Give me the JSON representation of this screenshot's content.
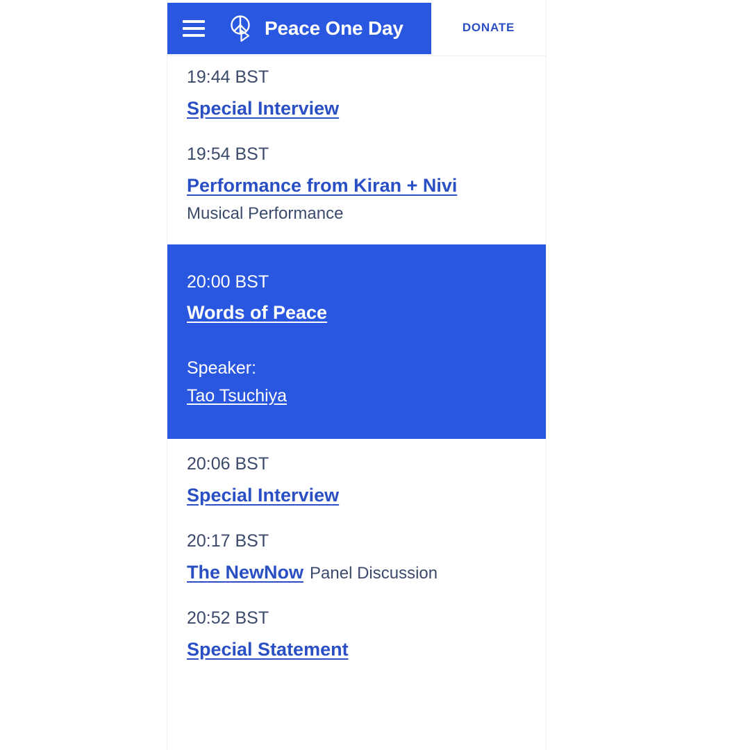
{
  "header": {
    "menu_icon": "hamburger-menu-icon",
    "logo_icon": "peace-sign-play-icon",
    "brand_title": "Peace One Day",
    "donate_label": "DONATE",
    "brand_bg": "#2a57e0",
    "donate_color": "#2a4fc4"
  },
  "colors": {
    "brand_blue": "#2a57e0",
    "link_blue": "#2a4fc4",
    "body_text": "#3b4a6b",
    "page_bg": "#ffffff",
    "highlight_text": "#ffffff"
  },
  "schedule": {
    "items": [
      {
        "time": "19:44 BST",
        "title": "Special Interview",
        "kind": "",
        "kind_inline": false,
        "highlight": false,
        "speaker_label": "",
        "speaker_name": ""
      },
      {
        "time": "19:54 BST",
        "title": "Performance from Kiran + Nivi",
        "kind": "Musical Performance",
        "kind_inline": false,
        "highlight": false,
        "speaker_label": "",
        "speaker_name": ""
      },
      {
        "time": "20:00 BST",
        "title": "Words of Peace",
        "kind": "",
        "kind_inline": false,
        "highlight": true,
        "speaker_label": "Speaker:",
        "speaker_name": "Tao Tsuchiya"
      },
      {
        "time": "20:06 BST",
        "title": "Special Interview",
        "kind": "",
        "kind_inline": false,
        "highlight": false,
        "speaker_label": "",
        "speaker_name": ""
      },
      {
        "time": "20:17 BST",
        "title": "The NewNow",
        "kind": "Panel Discussion",
        "kind_inline": true,
        "highlight": false,
        "speaker_label": "",
        "speaker_name": ""
      },
      {
        "time": "20:52 BST",
        "title": "Special Statement",
        "kind": "",
        "kind_inline": false,
        "highlight": false,
        "speaker_label": "",
        "speaker_name": ""
      }
    ]
  }
}
